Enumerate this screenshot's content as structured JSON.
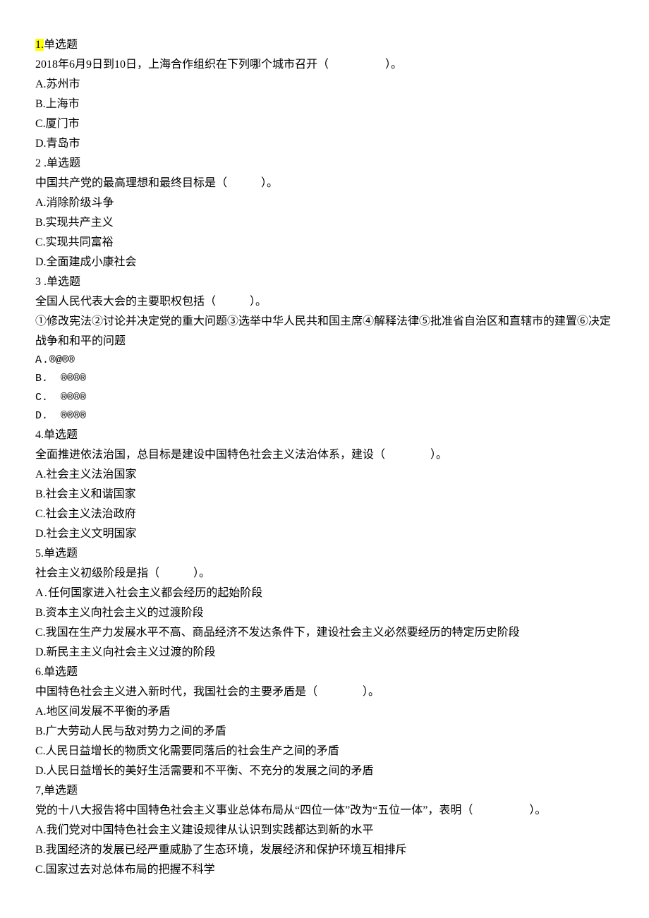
{
  "q1": {
    "label": "1.",
    "type": "单选题",
    "stem": "2018年6月9日到10日，上海合作组织在下列哪个城市召开（　　　　　）。",
    "A": "A.苏州市",
    "B": "B.上海市",
    "C": "C.厦门市",
    "D": "D.青岛市"
  },
  "q2": {
    "label": "2 .单选题",
    "stem": "中国共产党的最高理想和最终目标是（　　　）。",
    "A": "A.消除阶级斗争",
    "B": "B.实现共产主义",
    "C": "C.实现共同富裕",
    "D": "D.全面建成小康社会"
  },
  "q3": {
    "label": "3 .单选题",
    "stem": "全国人民代表大会的主要职权包括（　　　）。",
    "supp": "①修改宪法②讨论并决定党的重大问题③选举中华人民共和国主席④解释法律⑤批准省自治区和直辖市的建置⑥决定战争和和平的问题",
    "A": "A . ®@®®",
    "B": "B.  ®®®®",
    "C": "C.  ®®®®",
    "D": "D.  ®®®®"
  },
  "q4": {
    "label": "4.单选题",
    "stem": "全面推进依法治国，总目标是建设中国特色社会主义法治体系，建设（　　　　）。",
    "A": "A.社会主义法治国家",
    "B": "B.社会主义和谐国家",
    "C": "C.社会主义法治政府",
    "D": "D.社会主义文明国家"
  },
  "q5": {
    "label": "5.单选题",
    "stem": "社会主义初级阶段是指（　　　）。",
    "A": "A . 任何国家进入社会主义都会经历的起始阶段",
    "B": "B.资本主义向社会主义的过渡阶段",
    "C": "C.我国在生产力发展水平不高、商品经济不发达条件下，建设社会主义必然要经历的特定历史阶段",
    "D": "D.新民主主义向社会主义过渡的阶段"
  },
  "q6": {
    "label": "6.单选题",
    "stem": "中国特色社会主义进入新时代，我国社会的主要矛盾是（　　　　）。",
    "A": "A.地区间发展不平衡的矛盾",
    "B": "B.广大劳动人民与敌对势力之间的矛盾",
    "C": "C.人民日益增长的物质文化需要同落后的社会生产之间的矛盾",
    "D": "D.人民日益增长的美好生活需要和不平衡、不充分的发展之间的矛盾"
  },
  "q7": {
    "label": "7,单选题",
    "stem": "党的十八大报告将中国特色社会主义事业总体布局从“四位一体”改为“五位一体”，表明（　　　　　）。",
    "A": "A.我们党对中国特色社会主义建设规律从认识到实践都达到新的水平",
    "B": "B.我国经济的发展已经严重威胁了生态环境，发展经济和保护环境互相排斥",
    "C": "C.国家过去对总体布局的把握不科学"
  }
}
